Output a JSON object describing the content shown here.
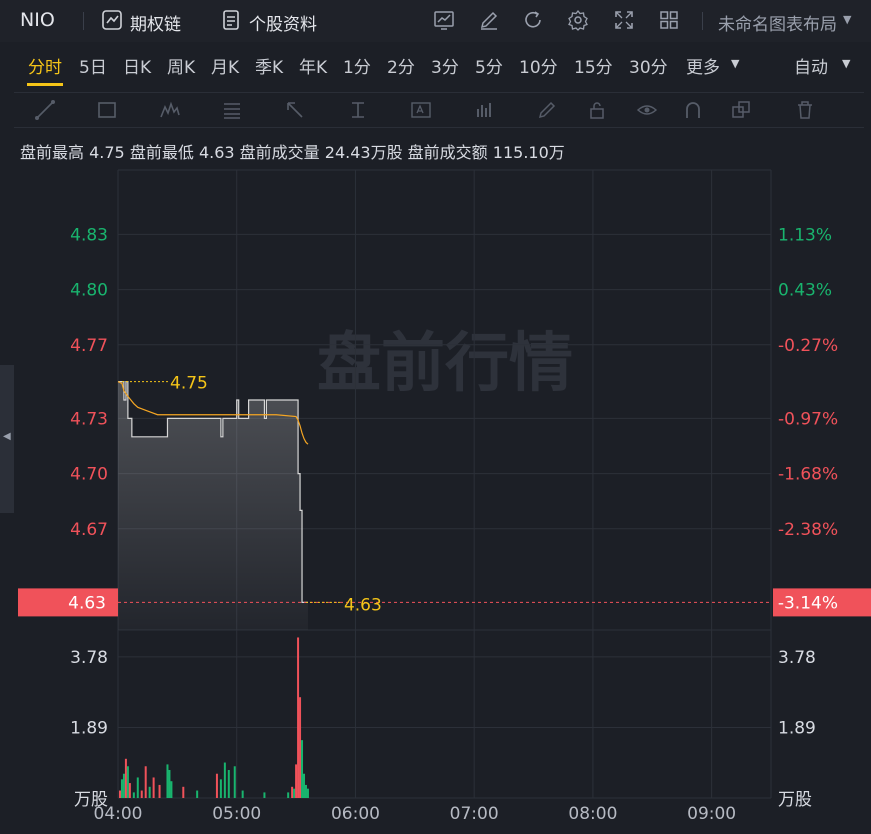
{
  "header": {
    "symbol": "NIO",
    "options_chain_label": "期权链",
    "stock_info_label": "个股资料",
    "layout_label": "未命名图表布局"
  },
  "periods": {
    "tabs": [
      "分时",
      "5日",
      "日K",
      "周K",
      "月K",
      "季K",
      "年K",
      "1分",
      "2分",
      "3分",
      "5分",
      "10分",
      "15分",
      "30分"
    ],
    "active": "分时",
    "more_label": "更多",
    "auto_label": "自动"
  },
  "toolbar_icons": [
    "line-tool-icon",
    "rectangle-tool-icon",
    "pattern-tool-icon",
    "fibonacci-tool-icon",
    "arrow-tool-icon",
    "measure-tool-icon",
    "text-tool-icon",
    "chart-type-icon",
    "pencil-icon",
    "lock-icon",
    "eye-icon",
    "magnet-icon",
    "layers-icon",
    "trash-icon"
  ],
  "premarket": {
    "high_label": "盘前最高",
    "high": "4.75",
    "low_label": "盘前最低",
    "low": "4.63",
    "volume_label": "盘前成交量",
    "volume": "24.43万股",
    "amount_label": "盘前成交额",
    "amount": "115.10万"
  },
  "colors": {
    "up": "#19b46e",
    "down": "#f0525a",
    "price_line": "#d6d6d6",
    "avg_line": "#f5a623",
    "accent": "#f5c518"
  },
  "chart_data": {
    "type": "line",
    "watermark": "盘前行情",
    "x_ticks": [
      "04:00",
      "05:00",
      "06:00",
      "07:00",
      "08:00",
      "09:00"
    ],
    "x_range": [
      "04:00",
      "09:30"
    ],
    "y_range": [
      4.615,
      4.865
    ],
    "y_ticks": [
      {
        "price": "4.83",
        "pct": "1.13%",
        "dir": "up"
      },
      {
        "price": "4.80",
        "pct": "0.43%",
        "dir": "up"
      },
      {
        "price": "4.77",
        "pct": "-0.27%",
        "dir": "down"
      },
      {
        "price": "4.73",
        "pct": "-0.97%",
        "dir": "down"
      },
      {
        "price": "4.70",
        "pct": "-1.68%",
        "dir": "down"
      },
      {
        "price": "4.67",
        "pct": "-2.38%",
        "dir": "down"
      }
    ],
    "current": {
      "price": "4.63",
      "pct": "-3.14%"
    },
    "high_marker": "4.75",
    "low_marker": "4.63",
    "price_series": {
      "time": [
        "04:00",
        "04:02",
        "04:03",
        "04:04",
        "04:05",
        "04:06",
        "04:07",
        "04:09",
        "04:13",
        "04:15",
        "04:20",
        "04:25",
        "04:30",
        "04:39",
        "04:40",
        "04:51",
        "04:52",
        "04:53",
        "04:59",
        "05:00",
        "05:01",
        "05:05",
        "05:06",
        "05:07",
        "05:14",
        "05:15",
        "05:20",
        "05:22",
        "05:24",
        "05:27",
        "05:28",
        "05:29",
        "05:30",
        "05:31",
        "05:32",
        "05:33",
        "05:36"
      ],
      "price": [
        4.75,
        4.75,
        4.74,
        4.75,
        4.73,
        4.73,
        4.72,
        4.72,
        4.72,
        4.72,
        4.72,
        4.73,
        4.73,
        4.73,
        4.73,
        4.73,
        4.72,
        4.73,
        4.73,
        4.74,
        4.73,
        4.73,
        4.74,
        4.74,
        4.73,
        4.74,
        4.74,
        4.74,
        4.74,
        4.74,
        4.74,
        4.74,
        4.74,
        4.7,
        4.68,
        4.63,
        4.63
      ]
    },
    "avg_series": {
      "time": [
        "04:00",
        "04:02",
        "04:03",
        "04:05",
        "04:08",
        "04:10",
        "04:15",
        "04:20",
        "04:30",
        "04:40",
        "04:50",
        "05:00",
        "05:10",
        "05:20",
        "05:30",
        "05:31",
        "05:32",
        "05:33",
        "05:34",
        "05:35",
        "05:36"
      ],
      "price": [
        4.75,
        4.749,
        4.745,
        4.742,
        4.738,
        4.736,
        4.734,
        4.732,
        4.732,
        4.732,
        4.732,
        4.732,
        4.732,
        4.732,
        4.731,
        4.729,
        4.726,
        4.722,
        4.719,
        4.717,
        4.716
      ]
    },
    "volume": {
      "unit": "万股",
      "ticks": [
        "3.78",
        "1.89"
      ],
      "y_max": 4.5,
      "bars": [
        {
          "time": "04:01",
          "v": 0.2,
          "dir": "down"
        },
        {
          "time": "04:02",
          "v": 0.5,
          "dir": "up"
        },
        {
          "time": "04:03",
          "v": 0.65,
          "dir": "up"
        },
        {
          "time": "04:04",
          "v": 1.05,
          "dir": "down"
        },
        {
          "time": "04:05",
          "v": 0.85,
          "dir": "up"
        },
        {
          "time": "04:06",
          "v": 0.4,
          "dir": "down"
        },
        {
          "time": "04:08",
          "v": 0.15,
          "dir": "up"
        },
        {
          "time": "04:10",
          "v": 0.55,
          "dir": "up"
        },
        {
          "time": "04:12",
          "v": 0.2,
          "dir": "down"
        },
        {
          "time": "04:14",
          "v": 0.85,
          "dir": "down"
        },
        {
          "time": "04:16",
          "v": 0.3,
          "dir": "up"
        },
        {
          "time": "04:18",
          "v": 0.55,
          "dir": "down"
        },
        {
          "time": "04:21",
          "v": 0.35,
          "dir": "down"
        },
        {
          "time": "04:25",
          "v": 0.9,
          "dir": "up"
        },
        {
          "time": "04:26",
          "v": 0.75,
          "dir": "up"
        },
        {
          "time": "04:27",
          "v": 0.45,
          "dir": "up"
        },
        {
          "time": "04:33",
          "v": 0.3,
          "dir": "down"
        },
        {
          "time": "04:40",
          "v": 0.2,
          "dir": "up"
        },
        {
          "time": "04:50",
          "v": 0.65,
          "dir": "down"
        },
        {
          "time": "04:52",
          "v": 0.5,
          "dir": "up"
        },
        {
          "time": "04:54",
          "v": 0.95,
          "dir": "up"
        },
        {
          "time": "04:56",
          "v": 0.75,
          "dir": "up"
        },
        {
          "time": "04:59",
          "v": 0.85,
          "dir": "up"
        },
        {
          "time": "05:03",
          "v": 0.2,
          "dir": "up"
        },
        {
          "time": "05:14",
          "v": 0.15,
          "dir": "up"
        },
        {
          "time": "05:26",
          "v": 0.15,
          "dir": "up"
        },
        {
          "time": "05:28",
          "v": 0.3,
          "dir": "down"
        },
        {
          "time": "05:29",
          "v": 0.25,
          "dir": "up"
        },
        {
          "time": "05:30",
          "v": 0.9,
          "dir": "down"
        },
        {
          "time": "05:31",
          "v": 4.3,
          "dir": "down"
        },
        {
          "time": "05:32",
          "v": 2.7,
          "dir": "down"
        },
        {
          "time": "05:33",
          "v": 1.55,
          "dir": "up"
        },
        {
          "time": "05:34",
          "v": 0.65,
          "dir": "up"
        },
        {
          "time": "05:35",
          "v": 0.35,
          "dir": "up"
        },
        {
          "time": "05:36",
          "v": 0.25,
          "dir": "up"
        }
      ]
    }
  }
}
